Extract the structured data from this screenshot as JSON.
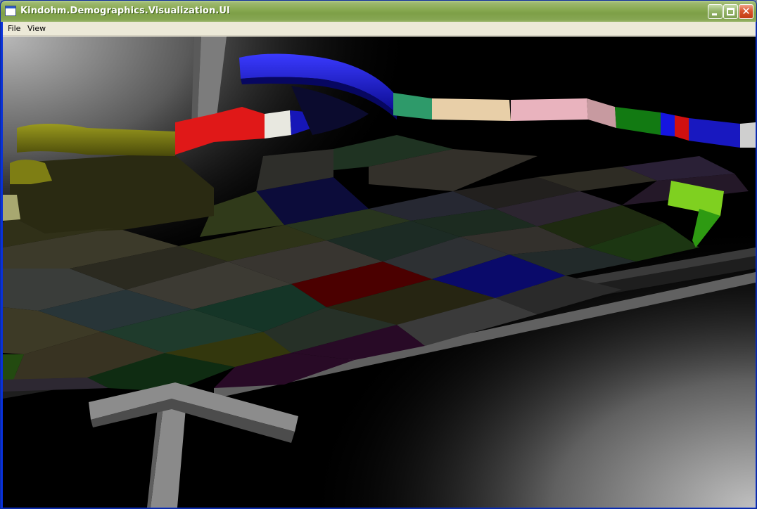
{
  "window": {
    "title": "Kindohm.Demographics.Visualization.UI"
  },
  "menu": {
    "items": [
      {
        "label": "File"
      },
      {
        "label": "View"
      }
    ]
  },
  "caption_buttons": {
    "minimize_icon": "minimize-icon",
    "maximize_icon": "maximize-icon",
    "close_icon": "close-icon"
  },
  "scene": {
    "description_colors": {
      "background": "#000000",
      "axis": "#8a8a8a"
    }
  }
}
